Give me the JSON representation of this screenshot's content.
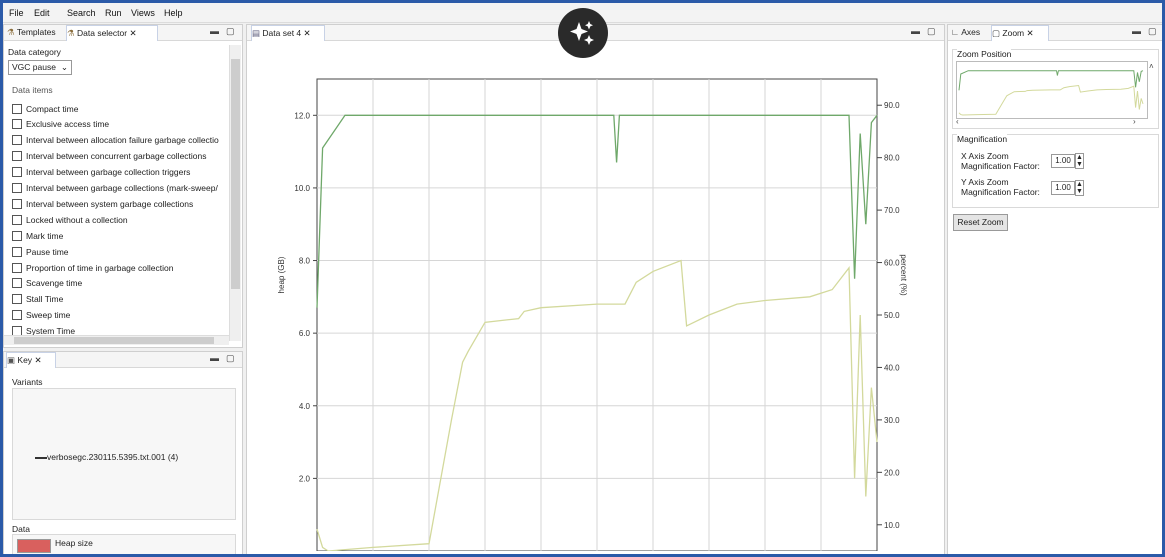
{
  "menu": [
    "File",
    "Edit",
    "Search",
    "Run",
    "Views",
    "Help"
  ],
  "left_pane": {
    "tabs": [
      "Templates",
      "Data selector"
    ],
    "category_label": "Data category",
    "category_value": "VGC pause",
    "items_label": "Data items",
    "items": [
      "Compact time",
      "Exclusive access time",
      "Interval between allocation failure garbage collectio",
      "Interval between concurrent garbage collections",
      "Interval between garbage collection triggers",
      "Interval between garbage collections (mark-sweep/",
      "Interval between system garbage collections",
      "Locked without a collection",
      "Mark time",
      "Pause time",
      "Proportion of time in garbage collection",
      "Scavenge time",
      "Stall Time",
      "Sweep time",
      "System Time"
    ]
  },
  "key_pane": {
    "tab": "Key",
    "variants_label": "Variants",
    "variant_entry": "verbosegc.230115.5395.txt.001 (4)",
    "data_label": "Data",
    "data_entry": "Heap size",
    "data_color": "#d9605e"
  },
  "center_pane": {
    "tab": "Data set 4"
  },
  "right_pane": {
    "tabs": [
      "Axes",
      "Zoom"
    ],
    "zoom_position_label": "Zoom Position",
    "magnification_label": "Magnification",
    "x_label_1": "X Axis Zoom",
    "x_label_2": "Magnification Factor:",
    "x_value": "1.00",
    "y_label_1": "Y Axis Zoom",
    "y_label_2": "Magnification Factor:",
    "y_value": "1.00",
    "reset_label": "Reset Zoom"
  },
  "chart_data": {
    "type": "line",
    "ylabel": "heap (GB)",
    "ylabel_right": "percent (%)",
    "yticks_left": [
      "12.0",
      "10.0",
      "8.0",
      "6.0",
      "4.0",
      "2.0"
    ],
    "ylim_left": [
      0,
      13
    ],
    "yticks_right": [
      "90.0",
      "80.0",
      "70.0",
      "60.0",
      "50.0",
      "40.0",
      "30.0",
      "20.0",
      "10.0"
    ],
    "ylim_right": [
      5,
      95
    ],
    "x_gridlines": 9,
    "series": [
      {
        "color": "#6fa86a",
        "x": [
          0,
          1,
          5,
          52,
          53,
          53.5,
          54,
          95,
          96,
          97,
          98,
          99,
          100
        ],
        "y": [
          6.7,
          11.1,
          12.0,
          12.0,
          12.0,
          10.7,
          12.0,
          12.0,
          7.5,
          11.5,
          9.0,
          11.8,
          12.0
        ]
      },
      {
        "color": "#d3d99c",
        "x": [
          0,
          1,
          2,
          10,
          20,
          24,
          26,
          27,
          30,
          36,
          37,
          40,
          50,
          55,
          57,
          60,
          65,
          66,
          70,
          75,
          80,
          88,
          92,
          95,
          96,
          97,
          98,
          99,
          100
        ],
        "y": [
          0.6,
          0.1,
          0.0,
          0.1,
          0.2,
          3.6,
          5.2,
          5.5,
          6.3,
          6.4,
          6.6,
          6.7,
          6.8,
          6.8,
          7.4,
          7.7,
          8.0,
          6.2,
          6.5,
          6.8,
          6.9,
          7.0,
          7.2,
          7.8,
          2.0,
          6.5,
          1.5,
          4.5,
          3.0
        ]
      }
    ]
  }
}
